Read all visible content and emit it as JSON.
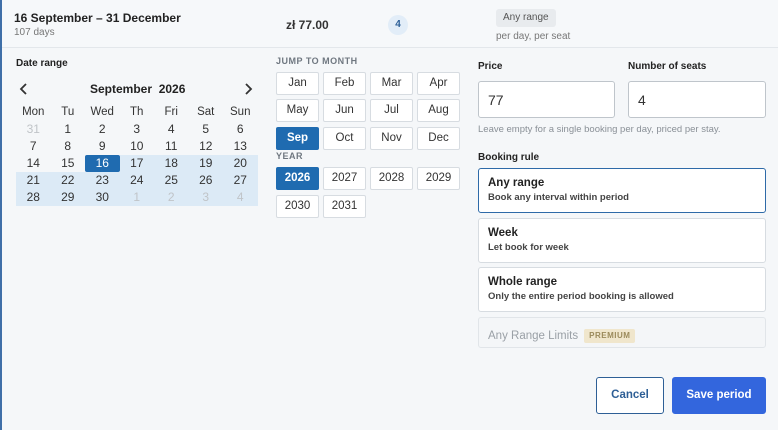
{
  "summary": {
    "period": "16 September – 31 December",
    "days": "107 days",
    "price": "zł 77.00",
    "seats": "4",
    "rule": "Any range",
    "rule_sub": "per day, per seat"
  },
  "calendar": {
    "section_label": "Date range",
    "month_title": "September  2026",
    "prev_icon": "chevron-left-icon",
    "next_icon": "chevron-right-icon",
    "weekdays": [
      "Mon",
      "Tu",
      "Wed",
      "Th",
      "Fri",
      "Sat",
      "Sun"
    ],
    "weeks": [
      [
        {
          "d": "31",
          "muted": true
        },
        {
          "d": "1"
        },
        {
          "d": "2"
        },
        {
          "d": "3"
        },
        {
          "d": "4"
        },
        {
          "d": "5"
        },
        {
          "d": "6"
        }
      ],
      [
        {
          "d": "7"
        },
        {
          "d": "8"
        },
        {
          "d": "9"
        },
        {
          "d": "10"
        },
        {
          "d": "11"
        },
        {
          "d": "12"
        },
        {
          "d": "13"
        }
      ],
      [
        {
          "d": "14"
        },
        {
          "d": "15"
        },
        {
          "d": "16",
          "selected": true
        },
        {
          "d": "17",
          "inrange": true
        },
        {
          "d": "18",
          "inrange": true
        },
        {
          "d": "19",
          "inrange": true
        },
        {
          "d": "20",
          "inrange": true
        }
      ],
      [
        {
          "d": "21",
          "inrange": true
        },
        {
          "d": "22",
          "inrange": true
        },
        {
          "d": "23",
          "inrange": true
        },
        {
          "d": "24",
          "inrange": true
        },
        {
          "d": "25",
          "inrange": true
        },
        {
          "d": "26",
          "inrange": true
        },
        {
          "d": "27",
          "inrange": true
        }
      ],
      [
        {
          "d": "28",
          "inrange": true
        },
        {
          "d": "29",
          "inrange": true
        },
        {
          "d": "30",
          "inrange": true
        },
        {
          "d": "1",
          "muted": true,
          "inrange": true
        },
        {
          "d": "2",
          "muted": true,
          "inrange": true
        },
        {
          "d": "3",
          "muted": true,
          "inrange": true
        },
        {
          "d": "4",
          "muted": true,
          "inrange": true
        }
      ]
    ]
  },
  "jump": {
    "label": "JUMP TO MONTH",
    "months": [
      "Jan",
      "Feb",
      "Mar",
      "Apr",
      "May",
      "Jun",
      "Jul",
      "Aug",
      "Sep",
      "Oct",
      "Nov",
      "Dec"
    ],
    "active_month": "Sep",
    "year_label": "YEAR",
    "years": [
      "2026",
      "2027",
      "2028",
      "2029",
      "2030",
      "2031"
    ],
    "active_year": "2026"
  },
  "form": {
    "price_label": "Price",
    "price_value": "77",
    "seats_label": "Number of seats",
    "seats_value": "4",
    "hint": "Leave empty for a single booking per day, priced per stay.",
    "rule_label": "Booking rule",
    "rules": [
      {
        "name": "Any range",
        "desc": "Book any interval within period"
      },
      {
        "name": "Week",
        "desc": "Let book for week"
      },
      {
        "name": "Whole range",
        "desc": "Only the entire period booking is allowed"
      }
    ],
    "limits_label": "Any Range Limits",
    "premium": "PREMIUM"
  },
  "actions": {
    "cancel": "Cancel",
    "save": "Save period"
  },
  "colors": {
    "accent": "#1f6bb0",
    "save_button": "#3366dd",
    "range_fill": "#dceaf6"
  }
}
